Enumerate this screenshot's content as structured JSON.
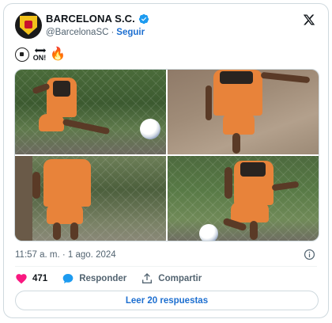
{
  "account": {
    "display_name": "BARCELONA S.C.",
    "handle": "@BarcelonaSC",
    "separator": "·",
    "follow_label": "Seguir",
    "verified_color": "#1d9bf0"
  },
  "tweet": {
    "emoji_sequence": [
      "soccer-ball",
      "on-arrow",
      "fire"
    ],
    "on_arrow_text": "ON!",
    "photos": [
      {
        "name": "photo-player-kicking-ball"
      },
      {
        "name": "photo-player-running-hillside"
      },
      {
        "name": "photo-player-walking-fence"
      },
      {
        "name": "photo-player-dribbling-ball"
      }
    ]
  },
  "meta": {
    "timestamp": "11:57 a. m. · 1 ago. 2024"
  },
  "actions": {
    "likes": "471",
    "reply_label": "Responder",
    "share_label": "Compartir"
  },
  "footer": {
    "read_replies_label": "Leer 20 respuestas"
  },
  "colors": {
    "accent": "#1d6fd0",
    "like": "#f91880",
    "muted": "#536471",
    "border": "#cfd9de"
  }
}
